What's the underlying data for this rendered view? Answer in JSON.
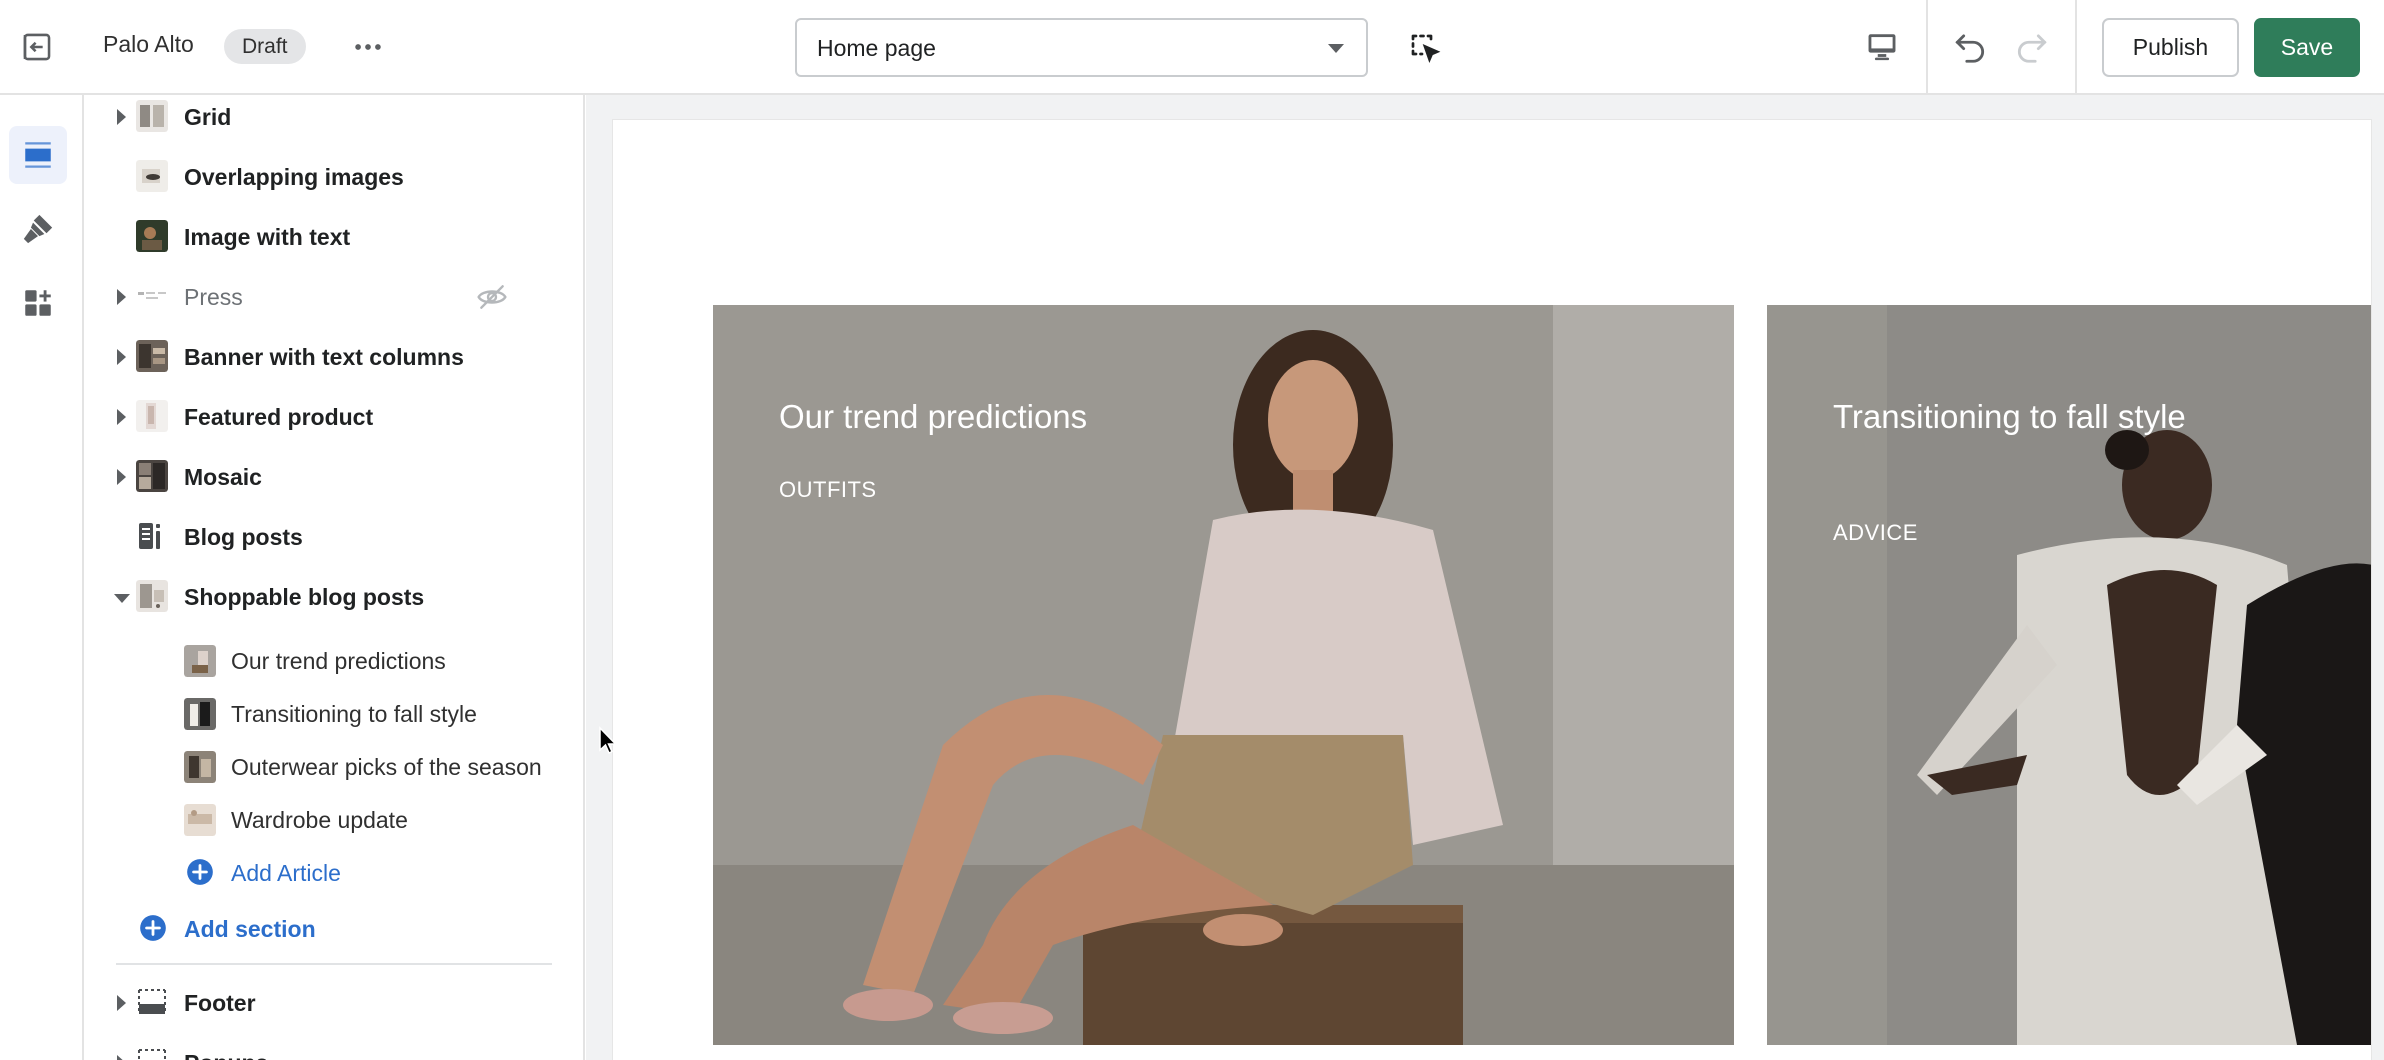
{
  "topbar": {
    "store_name": "Palo Alto",
    "status_badge": "Draft",
    "page_selector": "Home page",
    "publish_label": "Publish",
    "save_label": "Save",
    "icons": [
      "exit-icon",
      "more-icon",
      "inspector-icon",
      "desktop-icon",
      "undo-icon",
      "redo-icon"
    ]
  },
  "rail": {
    "items": [
      {
        "icon": "sections-icon",
        "active": true
      },
      {
        "icon": "theme-settings-icon",
        "active": false
      },
      {
        "icon": "app-embeds-icon",
        "active": false
      }
    ]
  },
  "sidebar": {
    "sections": [
      {
        "label": "Grid",
        "expandable": true
      },
      {
        "label": "Overlapping images",
        "expandable": false
      },
      {
        "label": "Image with text",
        "expandable": false
      },
      {
        "label": "Press",
        "expandable": true,
        "hidden": true
      },
      {
        "label": "Banner with text columns",
        "expandable": true
      },
      {
        "label": "Featured product",
        "expandable": true
      },
      {
        "label": "Mosaic",
        "expandable": true
      },
      {
        "label": "Blog posts",
        "expandable": false
      },
      {
        "label": "Shoppable blog posts",
        "expandable": true,
        "expanded": true
      }
    ],
    "articles": [
      {
        "label": "Our trend predictions"
      },
      {
        "label": "Transitioning to fall style"
      },
      {
        "label": "Outerwear picks of the season"
      },
      {
        "label": "Wardrobe update"
      }
    ],
    "add_article_label": "Add Article",
    "add_section_label": "Add section",
    "footer_sections": [
      {
        "label": "Footer",
        "expandable": true
      },
      {
        "label": "Popups",
        "expandable": true
      }
    ]
  },
  "preview": {
    "cards": [
      {
        "title": "Our trend predictions",
        "tag": "OUTFITS"
      },
      {
        "title": "Transitioning to fall style",
        "tag": "ADVICE"
      }
    ]
  },
  "colors": {
    "accent_blue": "#2c6ecb",
    "save_green": "#2f7d5a",
    "rail_active": "#edf1fb",
    "card1_bg": "#9a9791",
    "card2_bg": "#8b8985"
  }
}
